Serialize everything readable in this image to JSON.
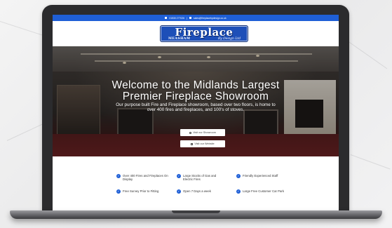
{
  "topbar": {
    "phone": "01530 277026",
    "email": "sales@fireplacebydesign.co.uk"
  },
  "logo": {
    "main": "Fireplace",
    "sub_left": "MEASHAM",
    "sub_right": "By Design Ltd"
  },
  "hero": {
    "title_line1": "Welcome to the Midlands Largest",
    "title_line2": "Premier Fireplace Showroom",
    "subtitle": "Our purpose built Fire and Fireplace showroom, based over two floors, is home to over 400 fires and fireplaces, and 100's of stoves.",
    "buttons": [
      {
        "label": "Visit our Showroom",
        "icon": "map-pin-icon"
      },
      {
        "label": "Visit our Website",
        "icon": "external-link-icon"
      }
    ]
  },
  "features": [
    {
      "label": "Over 400 Fires and Fireplaces On Display"
    },
    {
      "label": "Large Stocks of Gas and Electric Fires"
    },
    {
      "label": "Friendly Experienced Staff"
    },
    {
      "label": "Free Survey Prior to Fitting"
    },
    {
      "label": "Open 7 Days a week"
    },
    {
      "label": "Large Free Customer Car Park"
    }
  ],
  "colors": {
    "brand_blue": "#1f5fd6",
    "logo_blue": "#1d4fb8",
    "laptop_frame": "#2b2b2d"
  }
}
